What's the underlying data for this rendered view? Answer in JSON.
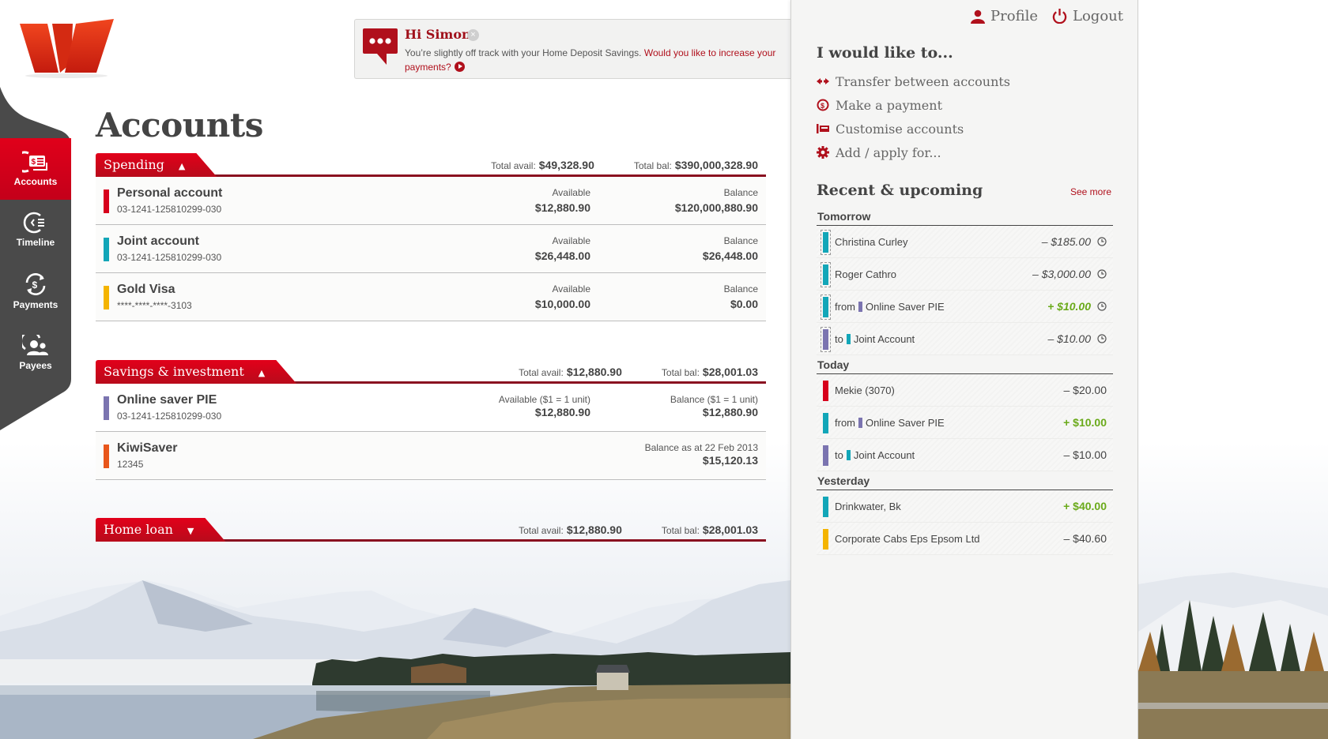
{
  "brand": {
    "accent": "#e2001a",
    "dark_red": "#a0101a",
    "sidebar_bg": "#4a4a4a",
    "positive": "#6aaa1a"
  },
  "sidebar": {
    "items": [
      {
        "label": "Accounts",
        "icon": "accounts-icon",
        "active": true
      },
      {
        "label": "Timeline",
        "icon": "timeline-icon",
        "active": false
      },
      {
        "label": "Payments",
        "icon": "payments-icon",
        "active": false
      },
      {
        "label": "Payees",
        "icon": "payees-icon",
        "active": false
      }
    ]
  },
  "notification": {
    "title": "Hi Simon",
    "message": "You’re slightly off track with your Home Deposit Savings.",
    "link": "Would you like to increase your payments?"
  },
  "main": {
    "title": "Accounts",
    "groups": [
      {
        "name": "Spending",
        "caret": "▲",
        "total_avail_label": "Total avail:",
        "total_avail": "$49,328.90",
        "total_bal_label": "Total bal:",
        "total_bal": "$390,000,328.90",
        "accounts": [
          {
            "name": "Personal account",
            "number": "03-1241-125810299-030",
            "color": "#d7001c",
            "avail_label": "Available",
            "avail": "$12,880.90",
            "bal_label": "Balance",
            "bal": "$120,000,880.90"
          },
          {
            "name": "Joint account",
            "number": "03-1241-125810299-030",
            "color": "#12a6b8",
            "avail_label": "Available",
            "avail": "$26,448.00",
            "bal_label": "Balance",
            "bal": "$26,448.00"
          },
          {
            "name": "Gold Visa",
            "number": "****-****-****-3103",
            "color": "#f4b400",
            "avail_label": "Available",
            "avail": "$10,000.00",
            "bal_label": "Balance",
            "bal": "$0.00"
          }
        ]
      },
      {
        "name": "Savings & investment",
        "caret": "▲",
        "total_avail_label": "Total avail:",
        "total_avail": "$12,880.90",
        "total_bal_label": "Total bal:",
        "total_bal": "$28,001.03",
        "accounts": [
          {
            "name": "Online saver PIE",
            "number": "03-1241-125810299-030",
            "color": "#7b74b0",
            "avail_label": "Available ($1 = 1 unit)",
            "avail": "$12,880.90",
            "bal_label": "Balance ($1 = 1 unit)",
            "bal": "$12,880.90"
          },
          {
            "name": "KiwiSaver",
            "number": "12345",
            "color": "#e8561b",
            "avail_label": "",
            "avail": "",
            "bal_label": "Balance as at 22 Feb 2013",
            "bal": "$15,120.13"
          }
        ]
      },
      {
        "name": "Home loan",
        "caret": "▼",
        "total_avail_label": "Total avail:",
        "total_avail": "$12,880.90",
        "total_bal_label": "Total bal:",
        "total_bal": "$28,001.03",
        "accounts": []
      }
    ]
  },
  "panel": {
    "profile": "Profile",
    "logout": "Logout",
    "quick_title": "I would like to...",
    "quick_links": [
      {
        "label": "Transfer between accounts",
        "icon": "transfer-icon"
      },
      {
        "label": "Make a payment",
        "icon": "payment-icon"
      },
      {
        "label": "Customise accounts",
        "icon": "customise-icon"
      },
      {
        "label": "Add / apply for...",
        "icon": "add-apply-icon"
      }
    ],
    "recent_title": "Recent & upcoming",
    "see_more": "See more",
    "days": [
      {
        "label": "Tomorrow",
        "items": [
          {
            "account_color": "#12a6b8",
            "prefix": "",
            "mini_color": "",
            "desc": "Christina Curley",
            "amount": "– $185.00",
            "positive": false,
            "scheduled": true
          },
          {
            "account_color": "#12a6b8",
            "prefix": "",
            "mini_color": "",
            "desc": "Roger Cathro",
            "amount": "– $3,000.00",
            "positive": false,
            "scheduled": true
          },
          {
            "account_color": "#12a6b8",
            "prefix": "from",
            "mini_color": "#7b74b0",
            "desc": "Online Saver PIE",
            "amount": "+ $10.00",
            "positive": true,
            "scheduled": true
          },
          {
            "account_color": "#7b74b0",
            "prefix": "to",
            "mini_color": "#12a6b8",
            "desc": "Joint Account",
            "amount": "– $10.00",
            "positive": false,
            "scheduled": true
          }
        ]
      },
      {
        "label": "Today",
        "items": [
          {
            "account_color": "#d7001c",
            "prefix": "",
            "mini_color": "",
            "desc": "Mekie (3070)",
            "amount": "– $20.00",
            "positive": false,
            "scheduled": false
          },
          {
            "account_color": "#12a6b8",
            "prefix": "from",
            "mini_color": "#7b74b0",
            "desc": "Online Saver PIE",
            "amount": "+ $10.00",
            "positive": true,
            "scheduled": false
          },
          {
            "account_color": "#7b74b0",
            "prefix": "to",
            "mini_color": "#12a6b8",
            "desc": "Joint Account",
            "amount": "– $10.00",
            "positive": false,
            "scheduled": false
          }
        ]
      },
      {
        "label": "Yesterday",
        "items": [
          {
            "account_color": "#12a6b8",
            "prefix": "",
            "mini_color": "",
            "desc": "Drinkwater, Bk",
            "amount": "+ $40.00",
            "positive": true,
            "scheduled": false
          },
          {
            "account_color": "#f4b400",
            "prefix": "",
            "mini_color": "",
            "desc": "Corporate Cabs Eps Epsom Ltd",
            "amount": "– $40.60",
            "positive": false,
            "scheduled": false
          }
        ]
      }
    ]
  }
}
